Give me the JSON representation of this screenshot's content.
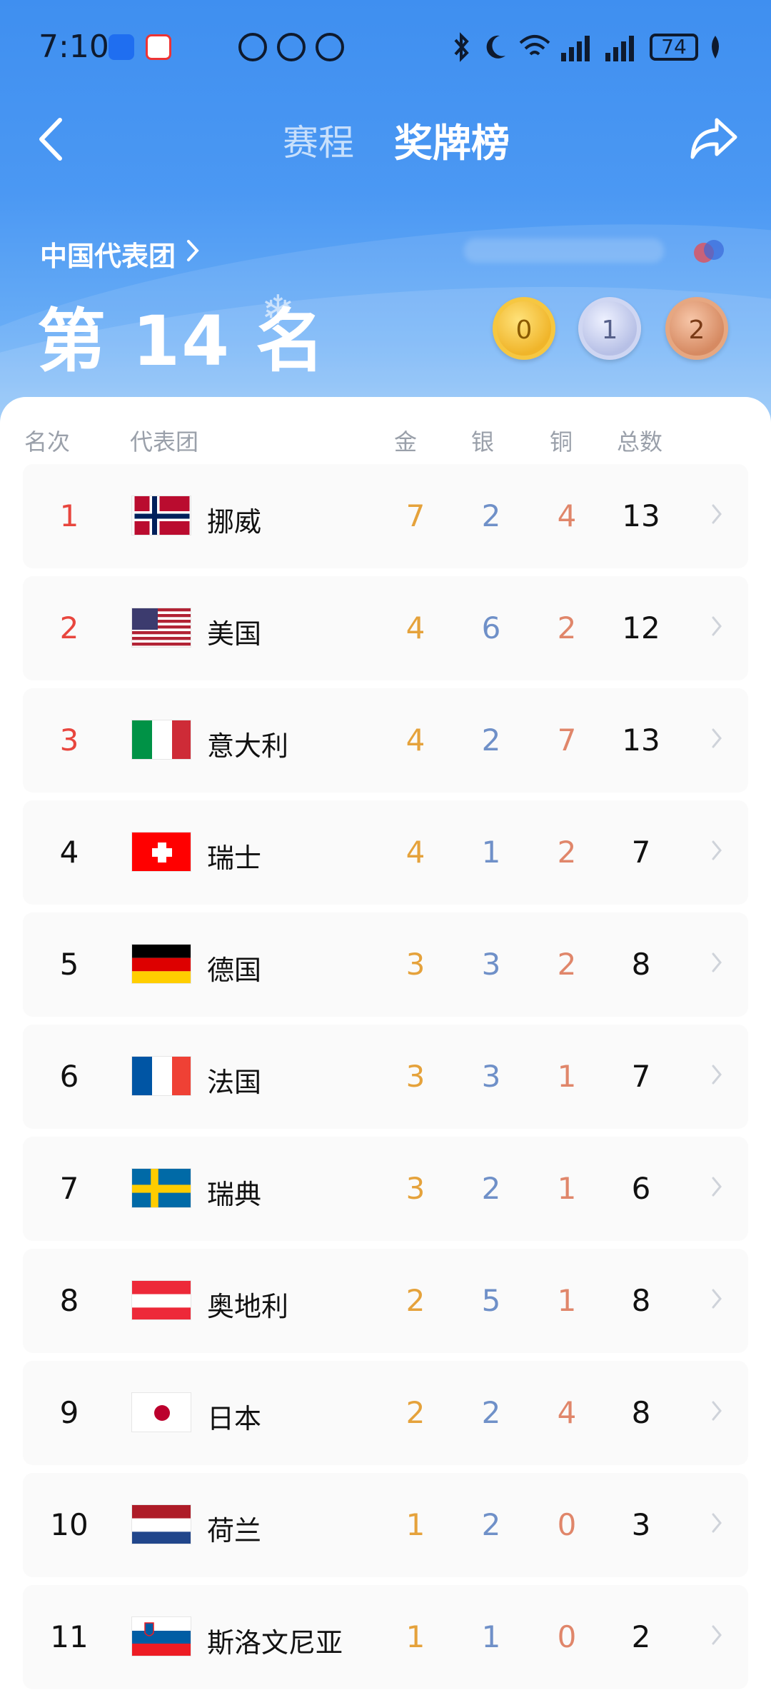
{
  "status_bar": {
    "time": "7:10",
    "battery": "74"
  },
  "nav": {
    "tabs": [
      "赛程",
      "奖牌榜"
    ],
    "active_tab": "奖牌榜",
    "back_icon": "chevron-left-icon",
    "share_icon": "share-icon"
  },
  "team": {
    "name": "中国代表团",
    "rank_text": "第 14 名",
    "gold": "0",
    "silver": "1",
    "bronze": "2"
  },
  "table": {
    "headers": {
      "rank": "名次",
      "team": "代表团",
      "gold": "金",
      "silver": "银",
      "bronze": "铜",
      "total": "总数"
    },
    "rows": [
      {
        "rank": "1",
        "name": "挪威",
        "gold": "7",
        "silver": "2",
        "bronze": "4",
        "total": "13",
        "flag": "norway"
      },
      {
        "rank": "2",
        "name": "美国",
        "gold": "4",
        "silver": "6",
        "bronze": "2",
        "total": "12",
        "flag": "usa"
      },
      {
        "rank": "3",
        "name": "意大利",
        "gold": "4",
        "silver": "2",
        "bronze": "7",
        "total": "13",
        "flag": "italy"
      },
      {
        "rank": "4",
        "name": "瑞士",
        "gold": "4",
        "silver": "1",
        "bronze": "2",
        "total": "7",
        "flag": "switzerland"
      },
      {
        "rank": "5",
        "name": "德国",
        "gold": "3",
        "silver": "3",
        "bronze": "2",
        "total": "8",
        "flag": "germany"
      },
      {
        "rank": "6",
        "name": "法国",
        "gold": "3",
        "silver": "3",
        "bronze": "1",
        "total": "7",
        "flag": "france"
      },
      {
        "rank": "7",
        "name": "瑞典",
        "gold": "3",
        "silver": "2",
        "bronze": "1",
        "total": "6",
        "flag": "sweden"
      },
      {
        "rank": "8",
        "name": "奥地利",
        "gold": "2",
        "silver": "5",
        "bronze": "1",
        "total": "8",
        "flag": "austria"
      },
      {
        "rank": "9",
        "name": "日本",
        "gold": "2",
        "silver": "2",
        "bronze": "4",
        "total": "8",
        "flag": "japan"
      },
      {
        "rank": "10",
        "name": "荷兰",
        "gold": "1",
        "silver": "2",
        "bronze": "0",
        "total": "3",
        "flag": "netherlands"
      },
      {
        "rank": "11",
        "name": "斯洛文尼亚",
        "gold": "1",
        "silver": "1",
        "bronze": "0",
        "total": "2",
        "flag": "slovenia"
      }
    ]
  },
  "colors": {
    "header_blue": "#3f8ff0",
    "gold": "#e5a23b",
    "silver": "#6f90c8",
    "bronze": "#e0866a",
    "top_rank": "#e8463e"
  }
}
